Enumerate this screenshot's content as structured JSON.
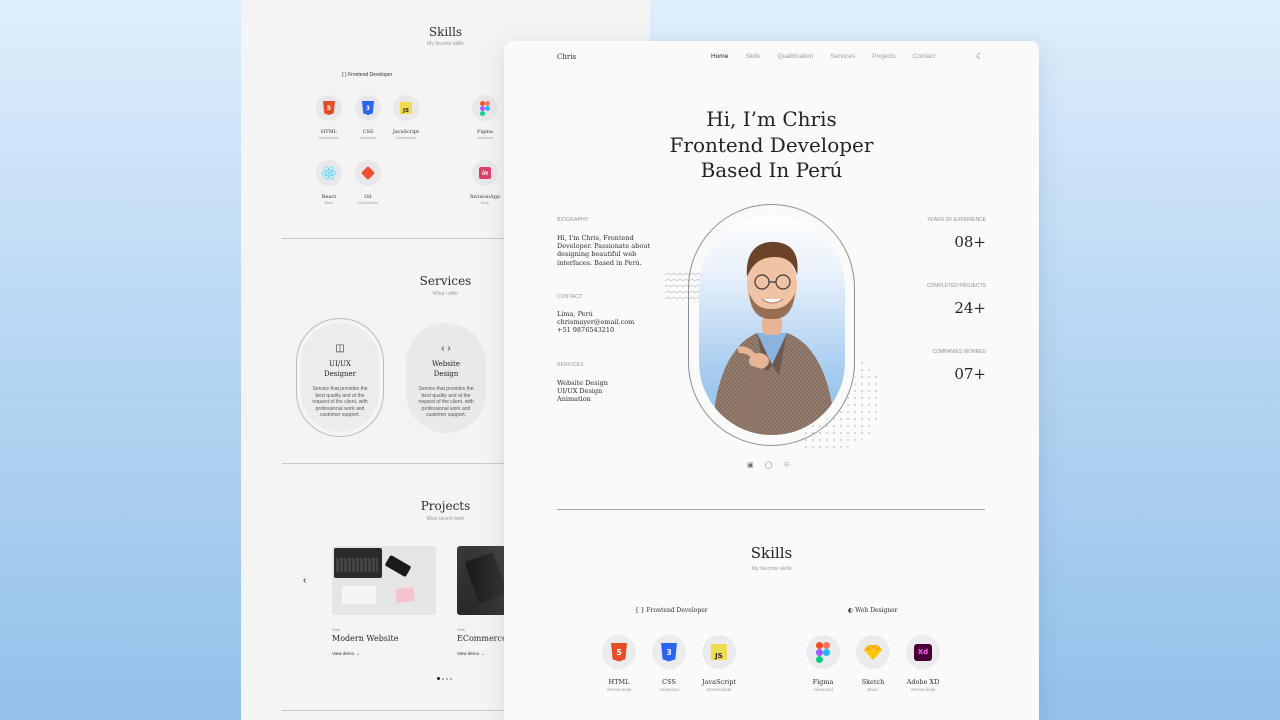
{
  "back_page": {
    "skills": {
      "title": "Skills",
      "subtitle": "My favorite skills",
      "frontend_heading": "Frontend Developer",
      "items": [
        {
          "name": "HTML",
          "level": "Intermediate"
        },
        {
          "name": "CSS",
          "level": "Advanced"
        },
        {
          "name": "JavaScript",
          "level": "Intermediate"
        },
        {
          "name": "Figma",
          "level": "Advanced"
        },
        {
          "name": "React",
          "level": "Basic"
        },
        {
          "name": "Git",
          "level": "Intermediate"
        },
        {
          "name": "InvisionApp",
          "level": "Basic"
        }
      ]
    },
    "services": {
      "title": "Services",
      "subtitle": "What i offer",
      "cards": [
        {
          "title_line1": "UI/UX",
          "title_line2": "Designer",
          "description": "Service that provides the best quality and at the request of the client, with professional work and customer support."
        },
        {
          "title_line1": "Website",
          "title_line2": "Design",
          "description": "Service that provides the best quality and at the request of the client, with professional work and customer support."
        }
      ]
    },
    "projects": {
      "title": "Projects",
      "subtitle": "Most recent work",
      "cards": [
        {
          "category": "Web",
          "title": "Modern Website",
          "link": "View demo"
        },
        {
          "category": "Web",
          "title": "ECommerce",
          "link": "View demo"
        }
      ]
    }
  },
  "nav": {
    "logo": "Chris",
    "items": [
      "Home",
      "Skills",
      "Qualification",
      "Services",
      "Projects",
      "Contact"
    ]
  },
  "hero": {
    "line1": "Hi, I’m Chris",
    "line2": "Frontend Developer",
    "line3": "Based In Perú"
  },
  "bio": {
    "biography_label": "BIOGRAPHY",
    "biography_lines": [
      "Hi, I'm Chris, Frontend",
      "Developer. Passionate about",
      "designing beautiful web",
      "interfaces. Based in Perú."
    ],
    "contact_label": "CONTACT",
    "contact_lines": [
      "Lima, Perú",
      "chrismayer@email.com",
      "+51 9876543210"
    ],
    "services_label": "SERVICES",
    "services_lines": [
      "Website Design",
      "UI/UX Design",
      "Animation"
    ]
  },
  "stats": [
    {
      "label": "YEARS OF EXPERIENCE",
      "value": "08+"
    },
    {
      "label": "COMPLETED PROJECTS",
      "value": "24+"
    },
    {
      "label": "COMPANIES WORKED",
      "value": "07+"
    }
  ],
  "skills": {
    "title": "Skills",
    "subtitle": "My favorite skills",
    "frontend_heading": "Frontend Developer",
    "designer_heading": "Web Designer",
    "frontend": [
      {
        "name": "HTML",
        "level": "Intermediate"
      },
      {
        "name": "CSS",
        "level": "Advanced"
      },
      {
        "name": "JavaScript",
        "level": "Intermediate"
      }
    ],
    "designer": [
      {
        "name": "Figma",
        "level": "Advanced"
      },
      {
        "name": "Sketch",
        "level": "Basic"
      },
      {
        "name": "Adobe XD",
        "level": "Intermediate"
      }
    ]
  },
  "icons": {
    "html": "html5-icon",
    "css": "css3-icon",
    "js": "javascript-icon",
    "figma": "figma-icon",
    "react": "react-icon",
    "git": "git-icon",
    "invision": "invision-icon",
    "sketch": "sketch-icon",
    "xd": "adobe-xd-icon"
  },
  "colors": {
    "html": "#e44d26",
    "css": "#2965f1",
    "js": "#f0db4f",
    "git": "#f05032",
    "invision": "#dc395f",
    "react": "#61dafb",
    "sketch": "#fdad00",
    "xd": "#470137",
    "background_top": "#dfeefb",
    "background_bottom": "#94c1ea"
  }
}
